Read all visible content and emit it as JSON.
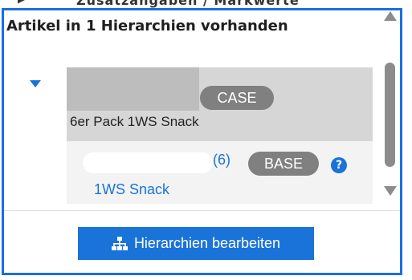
{
  "header": {
    "cut_off_text": "Zusatzangaben / Markwerte"
  },
  "panel": {
    "title": "Artikel in 1 Hierarchien vorhanden"
  },
  "hierarchy": {
    "case": {
      "badge": "CASE",
      "name": "6er Pack 1WS Snack"
    },
    "base": {
      "quantity": "(6)",
      "badge": "BASE",
      "help_icon": "?",
      "name": "1WS Snack"
    }
  },
  "actions": {
    "edit_label": "Hierarchien bearbeiten",
    "edit_icon": "hierarchy-icon"
  },
  "colors": {
    "accent": "#1a73d9",
    "border": "#1a6fe0",
    "badge": "#808080",
    "case_row_bg": "#d6d6d6",
    "base_row_bg": "#f3f3f3"
  }
}
